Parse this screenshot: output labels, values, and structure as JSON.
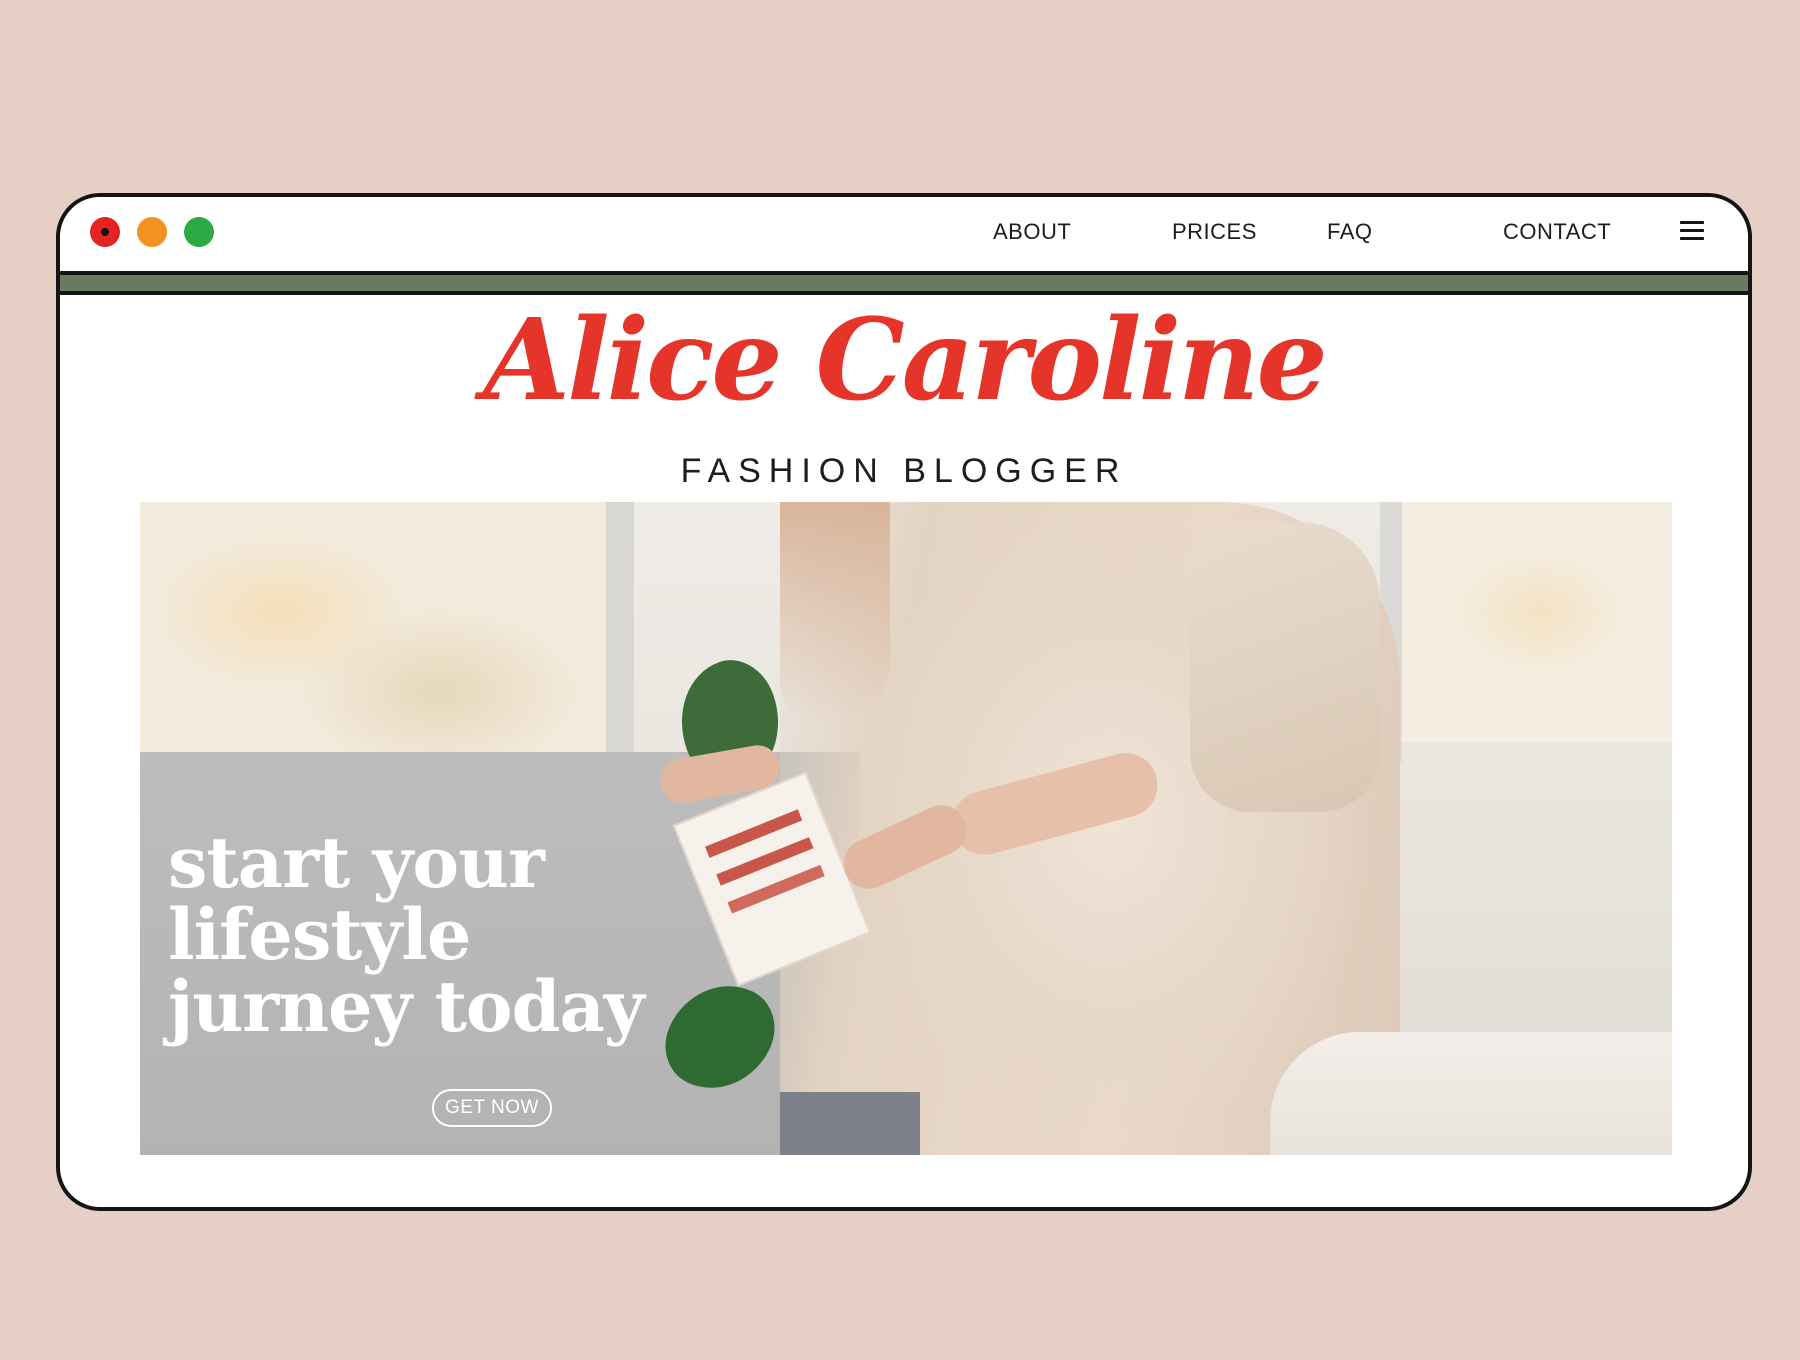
{
  "nav": {
    "items": [
      {
        "label": "ABOUT"
      },
      {
        "label": "PRICES"
      },
      {
        "label": "FAQ"
      },
      {
        "label": "CONTACT"
      }
    ],
    "menu_icon": "hamburger-menu-icon"
  },
  "window_controls": {
    "close_color": "#e52421",
    "minimize_color": "#f39420",
    "maximize_color": "#2eaa44"
  },
  "brand": {
    "title": "Alice Caroline",
    "subtitle": "FASHION BLOGGER",
    "accent_color": "#e5352a",
    "band_color": "#6a7a5f"
  },
  "hero": {
    "headline": "start your\nlifestyle\njurney today",
    "cta_label": "GET NOW"
  }
}
